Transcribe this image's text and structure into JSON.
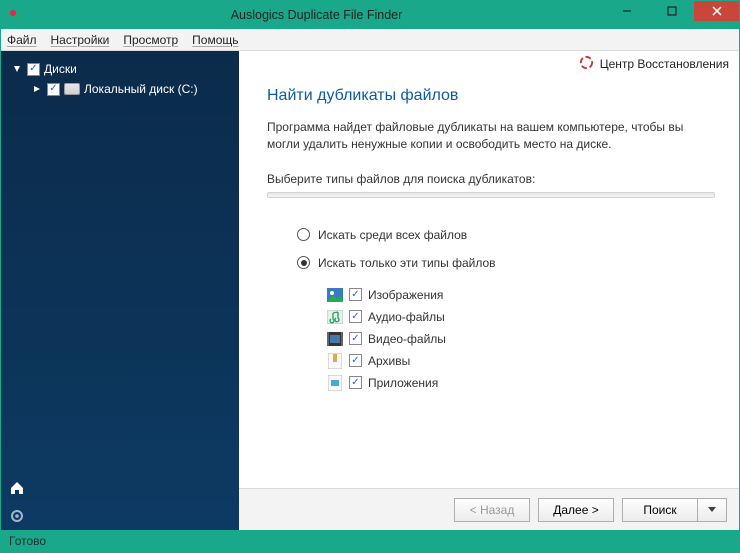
{
  "window": {
    "title": "Auslogics Duplicate File Finder"
  },
  "menu": {
    "file": "Файл",
    "settings": "Настройки",
    "view": "Просмотр",
    "help": "Помощь"
  },
  "restore": {
    "label": "Центр Восстановления"
  },
  "tree": {
    "root": "Диски",
    "drive": "Локальный диск (C:)"
  },
  "main": {
    "heading": "Найти дубликаты файлов",
    "description": "Программа найдет файловые дубликаты на вашем компьютере, чтобы вы могли удалить ненужные копии и освободить место на диске.",
    "section_label": "Выберите типы файлов для поиска дубликатов:",
    "radio_all": "Искать среди всех файлов",
    "radio_only": "Искать только эти типы файлов",
    "types": {
      "images": "Изображения",
      "audio": "Аудио-файлы",
      "video": "Видео-файлы",
      "archives": "Архивы",
      "apps": "Приложения"
    }
  },
  "footer": {
    "back": "< Назад",
    "next": "Далее >",
    "search": "Поиск"
  },
  "status": {
    "text": "Готово"
  }
}
